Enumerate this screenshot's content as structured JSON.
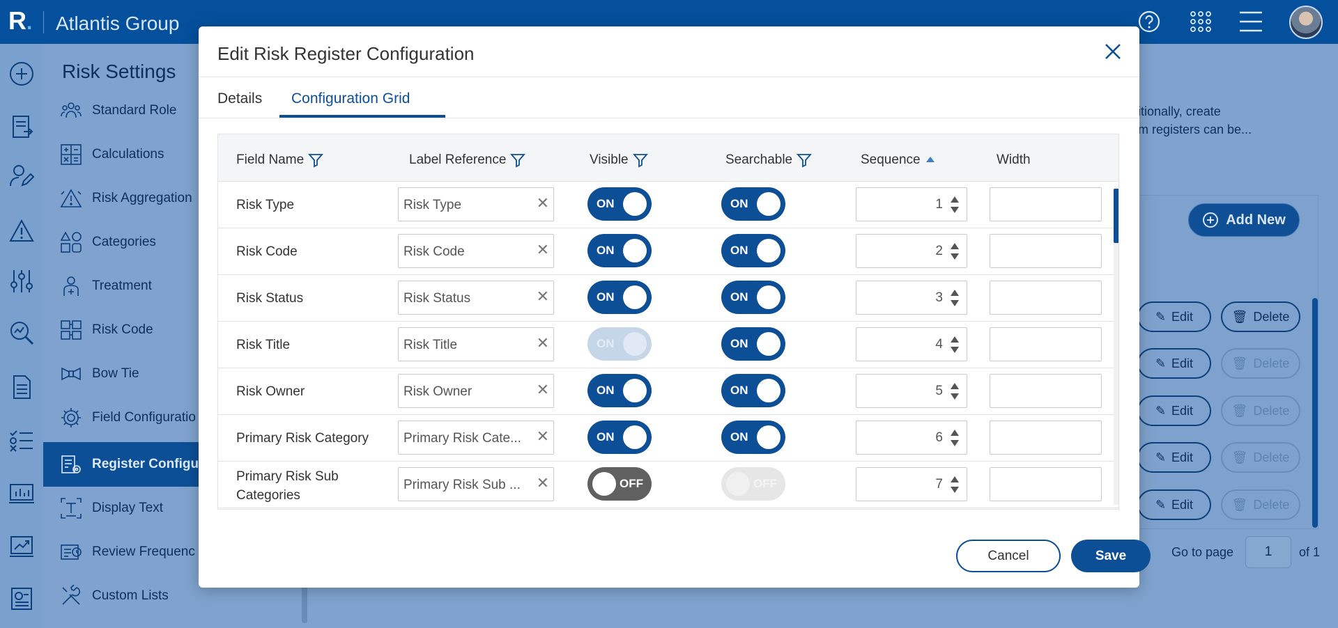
{
  "app": {
    "title": "Atlantis Group",
    "logo_letter": "R"
  },
  "topbar_icons": [
    "help-icon",
    "apps-grid-icon",
    "hamburger-menu-icon",
    "user-avatar"
  ],
  "left_rail_icons": [
    "add-circle-icon",
    "document-arrow-icon",
    "user-edit-icon",
    "warning-icon",
    "sliders-icon",
    "search-chart-icon",
    "report-icon",
    "checklist-icon",
    "monitor-chart-icon",
    "trend-chart-icon",
    "dashboard-doc-icon"
  ],
  "sidenav": {
    "title": "Risk Settings",
    "items": [
      {
        "label": "Standard Role",
        "icon": "people-icon"
      },
      {
        "label": "Calculations",
        "icon": "calculator-icon"
      },
      {
        "label": "Risk Aggregation",
        "icon": "aggregation-icon"
      },
      {
        "label": "Categories",
        "icon": "categories-icon"
      },
      {
        "label": "Treatment",
        "icon": "treatment-icon"
      },
      {
        "label": "Risk Code",
        "icon": "code-icon"
      },
      {
        "label": "Bow Tie",
        "icon": "bow-tie-icon"
      },
      {
        "label": "Field Configuratio",
        "icon": "gear-icon"
      },
      {
        "label": "Register Configu",
        "icon": "register-config-icon",
        "active": true
      },
      {
        "label": "Display Text",
        "icon": "text-icon"
      },
      {
        "label": "Review Frequenc",
        "icon": "review-icon"
      },
      {
        "label": "Custom Lists",
        "icon": "tools-icon"
      }
    ]
  },
  "background": {
    "description_line1": "itionally, create",
    "description_line2": "m registers can be...",
    "add_new_label": "Add New",
    "edit_label": "Edit",
    "delete_label": "Delete",
    "go_to_page_label": "Go to page",
    "page_number": "1",
    "page_total_label": "of 1"
  },
  "modal": {
    "title": "Edit Risk Register Configuration",
    "tabs": [
      {
        "label": "Details"
      },
      {
        "label": "Configuration Grid",
        "active": true
      }
    ],
    "columns": {
      "field_name": "Field Name",
      "label_reference": "Label Reference",
      "visible": "Visible",
      "searchable": "Searchable",
      "sequence": "Sequence",
      "width": "Width"
    },
    "sort": {
      "column": "sequence",
      "direction": "ascending"
    },
    "rows": [
      {
        "field": "Risk Type",
        "label": "Risk Type",
        "visible": "ON",
        "visible_disabled": false,
        "searchable": "ON",
        "searchable_disabled": false,
        "sequence": "1",
        "width": ""
      },
      {
        "field": "Risk Code",
        "label": "Risk Code",
        "visible": "ON",
        "visible_disabled": false,
        "searchable": "ON",
        "searchable_disabled": false,
        "sequence": "2",
        "width": ""
      },
      {
        "field": "Risk Status",
        "label": "Risk Status",
        "visible": "ON",
        "visible_disabled": false,
        "searchable": "ON",
        "searchable_disabled": false,
        "sequence": "3",
        "width": ""
      },
      {
        "field": "Risk Title",
        "label": "Risk Title",
        "visible": "ON",
        "visible_disabled": true,
        "searchable": "ON",
        "searchable_disabled": false,
        "sequence": "4",
        "width": ""
      },
      {
        "field": "Risk Owner",
        "label": "Risk Owner",
        "visible": "ON",
        "visible_disabled": false,
        "searchable": "ON",
        "searchable_disabled": false,
        "sequence": "5",
        "width": ""
      },
      {
        "field": "Primary Risk Category",
        "label": "Primary Risk Cate...",
        "visible": "ON",
        "visible_disabled": false,
        "searchable": "ON",
        "searchable_disabled": false,
        "sequence": "6",
        "width": ""
      },
      {
        "field": "Primary Risk Sub Categories",
        "label": "Primary Risk Sub ...",
        "visible": "OFF",
        "visible_disabled": false,
        "searchable": "OFF",
        "searchable_disabled": true,
        "sequence": "7",
        "width": ""
      }
    ],
    "cancel_label": "Cancel",
    "save_label": "Save"
  },
  "colors": {
    "brand": "#04509c",
    "accent": "#0d4f96",
    "toggle_off": "#606060"
  }
}
